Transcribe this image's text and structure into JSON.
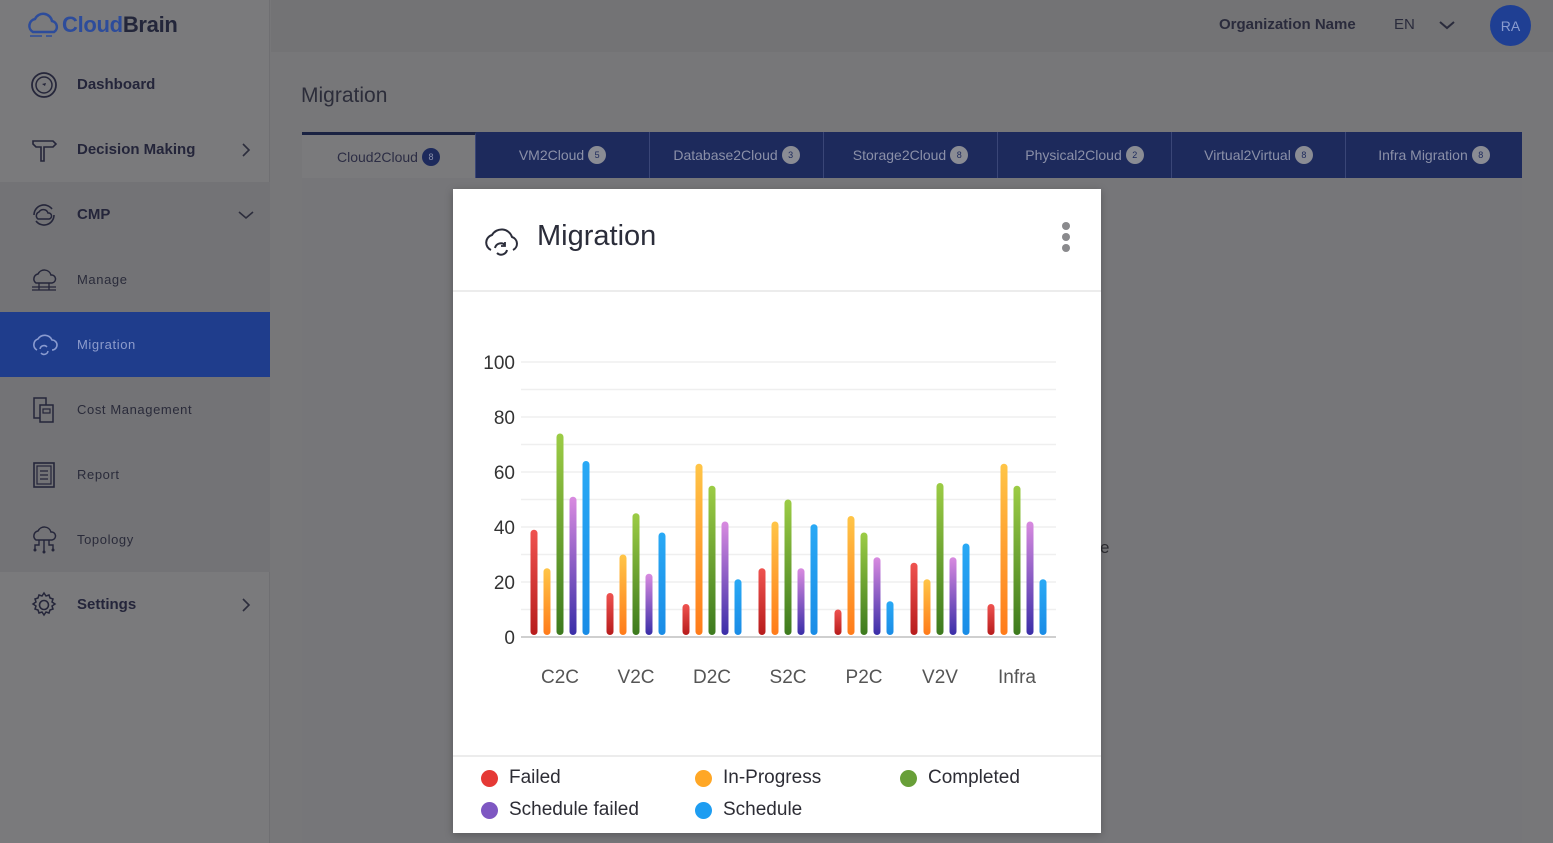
{
  "app": {
    "brand_part1": "Cloud",
    "brand_part2": "Brain"
  },
  "header": {
    "org_name": "Organization Name",
    "language": "EN",
    "avatar_initials": "RA"
  },
  "sidebar": {
    "items": [
      {
        "label": "Dashboard",
        "icon": "dashboard-gauge-icon"
      },
      {
        "label": "Decision Making",
        "icon": "signpost-icon",
        "chevron": "right"
      },
      {
        "label": "CMP",
        "icon": "cloud-sync-icon",
        "chevron": "down"
      },
      {
        "label": "Manage",
        "icon": "cloud-network-icon"
      },
      {
        "label": "Migration",
        "icon": "cloud-migration-icon",
        "active": true
      },
      {
        "label": "Cost Management",
        "icon": "cost-documents-icon"
      },
      {
        "label": "Report",
        "icon": "clipboard-report-icon"
      },
      {
        "label": "Topology",
        "icon": "cloud-topology-icon"
      },
      {
        "label": "Settings",
        "icon": "gear-icon",
        "chevron": "right"
      }
    ]
  },
  "page": {
    "title": "Migration",
    "background_text_fragment": "e"
  },
  "tabs": [
    {
      "label": "Cloud2Cloud",
      "count": "8",
      "active": true
    },
    {
      "label": "VM2Cloud",
      "count": "5"
    },
    {
      "label": "Database2Cloud",
      "count": "3"
    },
    {
      "label": "Storage2Cloud",
      "count": "8"
    },
    {
      "label": "Physical2Cloud",
      "count": "2"
    },
    {
      "label": "Virtual2Virtual",
      "count": "8"
    },
    {
      "label": "Infra Migration",
      "count": "8"
    }
  ],
  "card": {
    "title": "Migration",
    "menu_icon": "kebab-menu-icon"
  },
  "chart_data": {
    "type": "bar",
    "title": "Migration",
    "xlabel": "",
    "ylabel": "",
    "ylim": [
      0,
      100
    ],
    "yticks": [
      0,
      20,
      40,
      60,
      80,
      100
    ],
    "grid": true,
    "legend_position": "bottom",
    "categories": [
      "C2C",
      "V2C",
      "D2C",
      "S2C",
      "P2C",
      "V2V",
      "Infra"
    ],
    "series": [
      {
        "name": "Failed",
        "color": "#e53935",
        "values": [
          39,
          16,
          12,
          25,
          10,
          27,
          12
        ]
      },
      {
        "name": "In-Progress",
        "color": "#ffa726",
        "values": [
          25,
          30,
          63,
          42,
          44,
          21,
          63
        ]
      },
      {
        "name": "Completed",
        "color": "#689f38",
        "values": [
          74,
          45,
          55,
          50,
          38,
          56,
          55
        ]
      },
      {
        "name": "Schedule failed",
        "color": "#7e57c2",
        "values": [
          51,
          23,
          42,
          25,
          29,
          29,
          42
        ]
      },
      {
        "name": "Schedule",
        "color": "#1e9df1",
        "values": [
          64,
          38,
          21,
          41,
          13,
          34,
          21
        ]
      }
    ]
  }
}
